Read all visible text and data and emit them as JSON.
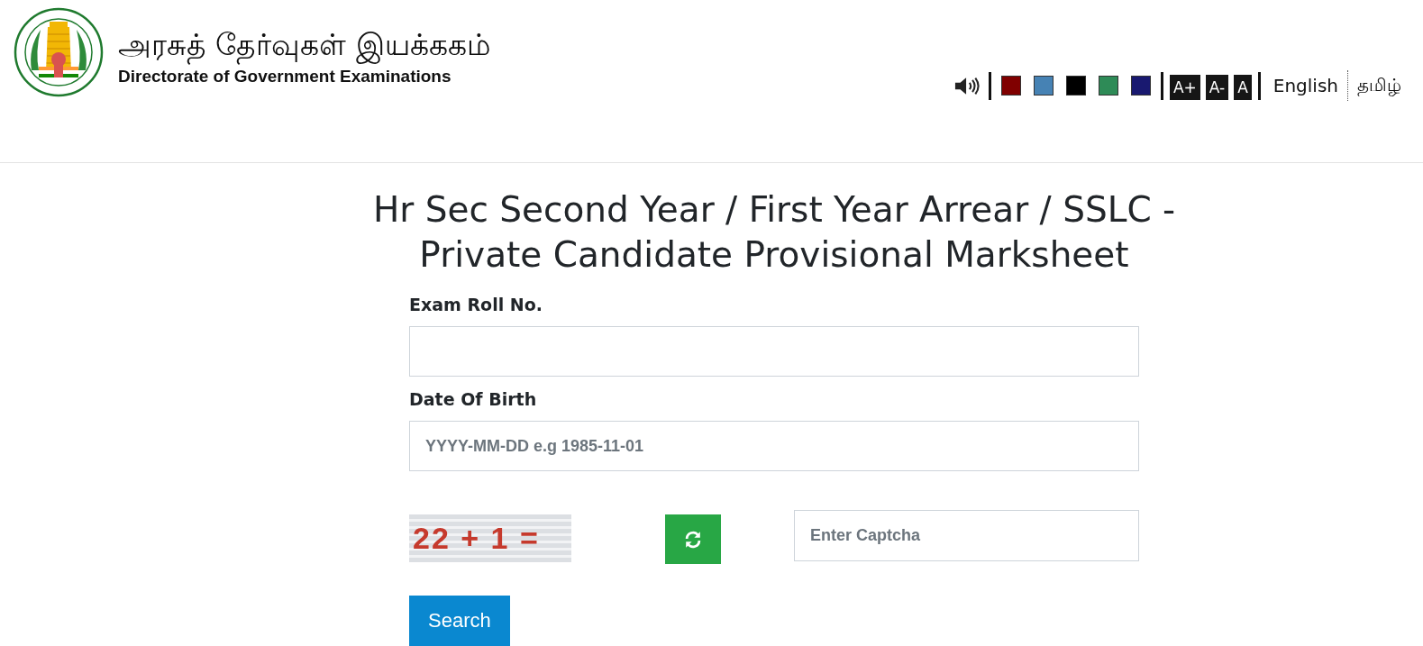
{
  "header": {
    "title": "அரசுத் தேர்வுகள் இயக்ககம்",
    "subtitle": "Directorate of Government Examinations"
  },
  "toolbar": {
    "themes": [
      {
        "color": "#800000"
      },
      {
        "color": "#4682b4"
      },
      {
        "color": "#000000"
      },
      {
        "color": "#2e8b57"
      },
      {
        "color": "#191970"
      }
    ],
    "font_sizes": [
      "A+",
      "A-",
      "A"
    ],
    "languages": [
      "English",
      "தமிழ்"
    ]
  },
  "form": {
    "title": "Hr Sec Second Year / First Year Arrear / SSLC - Private Candidate Provisional Marksheet",
    "fields": [
      {
        "label": "Exam Roll No."
      },
      {
        "label": "Date Of Birth",
        "placeholder": "YYYY-MM-DD e.g 1985-11-01"
      }
    ],
    "captcha": {
      "text": "22 + 1 =",
      "placeholder": "Enter Captcha"
    },
    "submit": "Search"
  }
}
